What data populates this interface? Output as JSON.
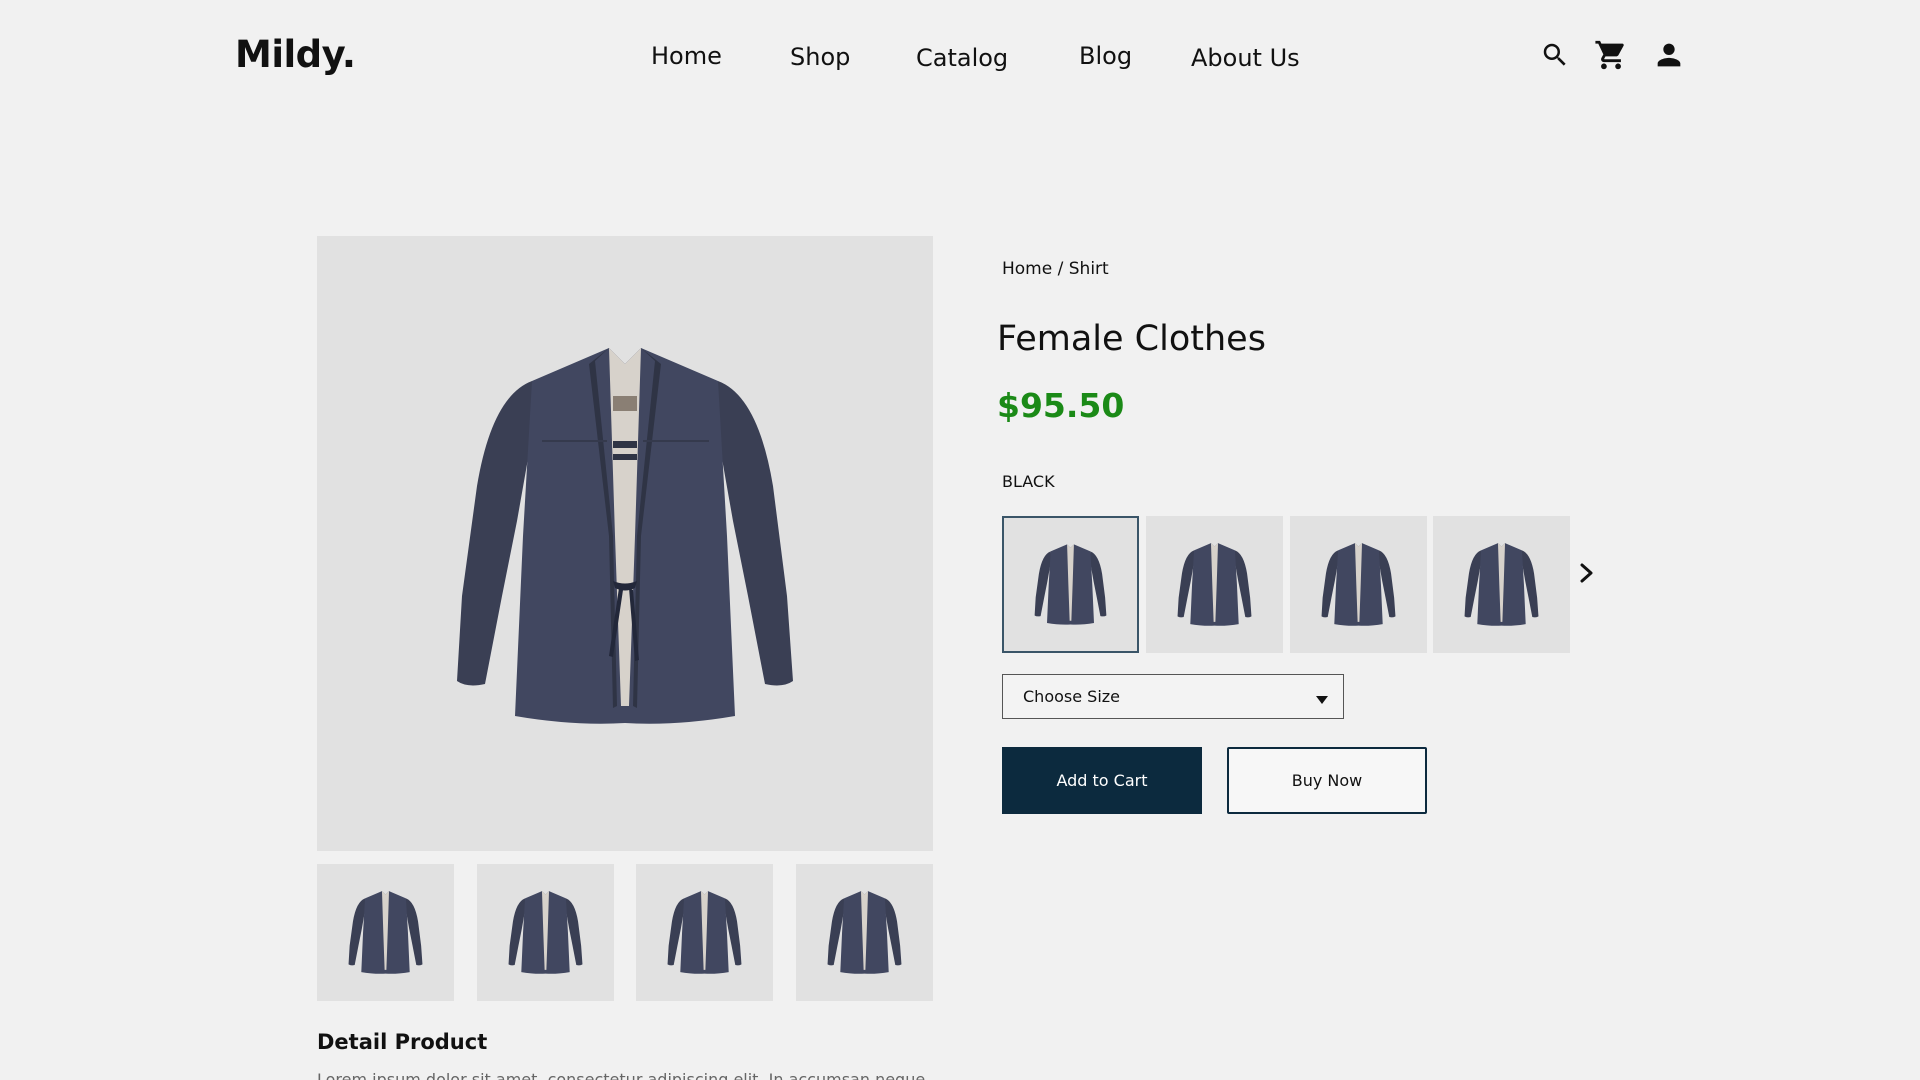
{
  "header": {
    "logo": "Mildy.",
    "nav": [
      "Home",
      "Shop",
      "Catalog",
      "Blog",
      "About Us"
    ],
    "icons": [
      "search-icon",
      "cart-icon",
      "user-icon"
    ]
  },
  "product": {
    "breadcrumb": {
      "home": "Home",
      "separator": "/",
      "current": "Shirt"
    },
    "title": "Female Clothes",
    "price": "$95.50",
    "color_label": "BLACK",
    "size_select": {
      "value": "Choose Size"
    },
    "buttons": {
      "add_to_cart": "Add to Cart",
      "buy_now": "Buy Now"
    },
    "detail_title": "Detail Product",
    "detail_text": "Lorem ipsum dolor sit amet, consectetur adipiscing elit. In accumsan neque"
  },
  "colors": {
    "background": "#f1f1f1",
    "image_bg": "#e1e1e1",
    "price_green": "#1b8a17",
    "primary_button": "#0c2a3e",
    "jacket": "#3f4459"
  }
}
